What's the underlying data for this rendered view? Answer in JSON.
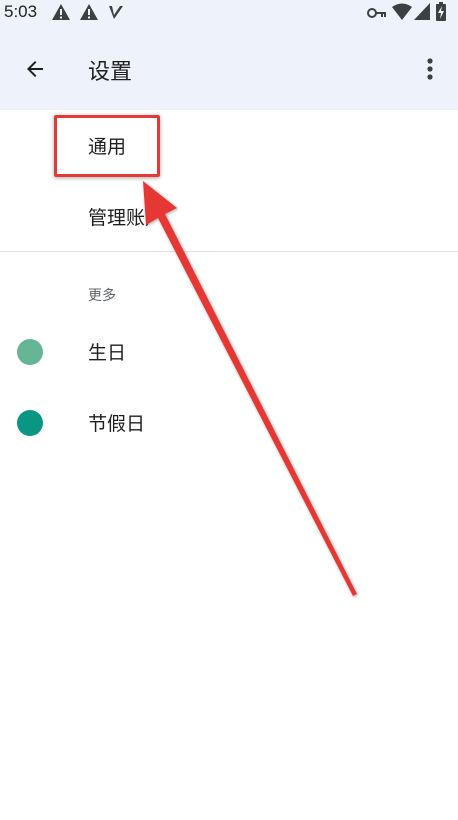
{
  "status_bar": {
    "time": "5:03",
    "left_icons": [
      "warning-icon",
      "warning-icon",
      "signal-v-icon"
    ],
    "right_icons": [
      "key-icon",
      "wifi-icon",
      "cell-signal-icon",
      "battery-icon"
    ]
  },
  "app_bar": {
    "title": "设置",
    "back_icon": "arrow-back-icon",
    "more_icon": "more-vert-icon"
  },
  "settings": {
    "items": [
      {
        "label": "通用"
      },
      {
        "label": "管理账户"
      }
    ]
  },
  "more_section": {
    "header": "更多",
    "items": [
      {
        "label": "生日",
        "color": "#66b594"
      },
      {
        "label": "节假日",
        "color": "#0b9684"
      }
    ]
  },
  "colors": {
    "app_bar_bg": "#eef2fb",
    "annotation_red": "#e53935"
  }
}
